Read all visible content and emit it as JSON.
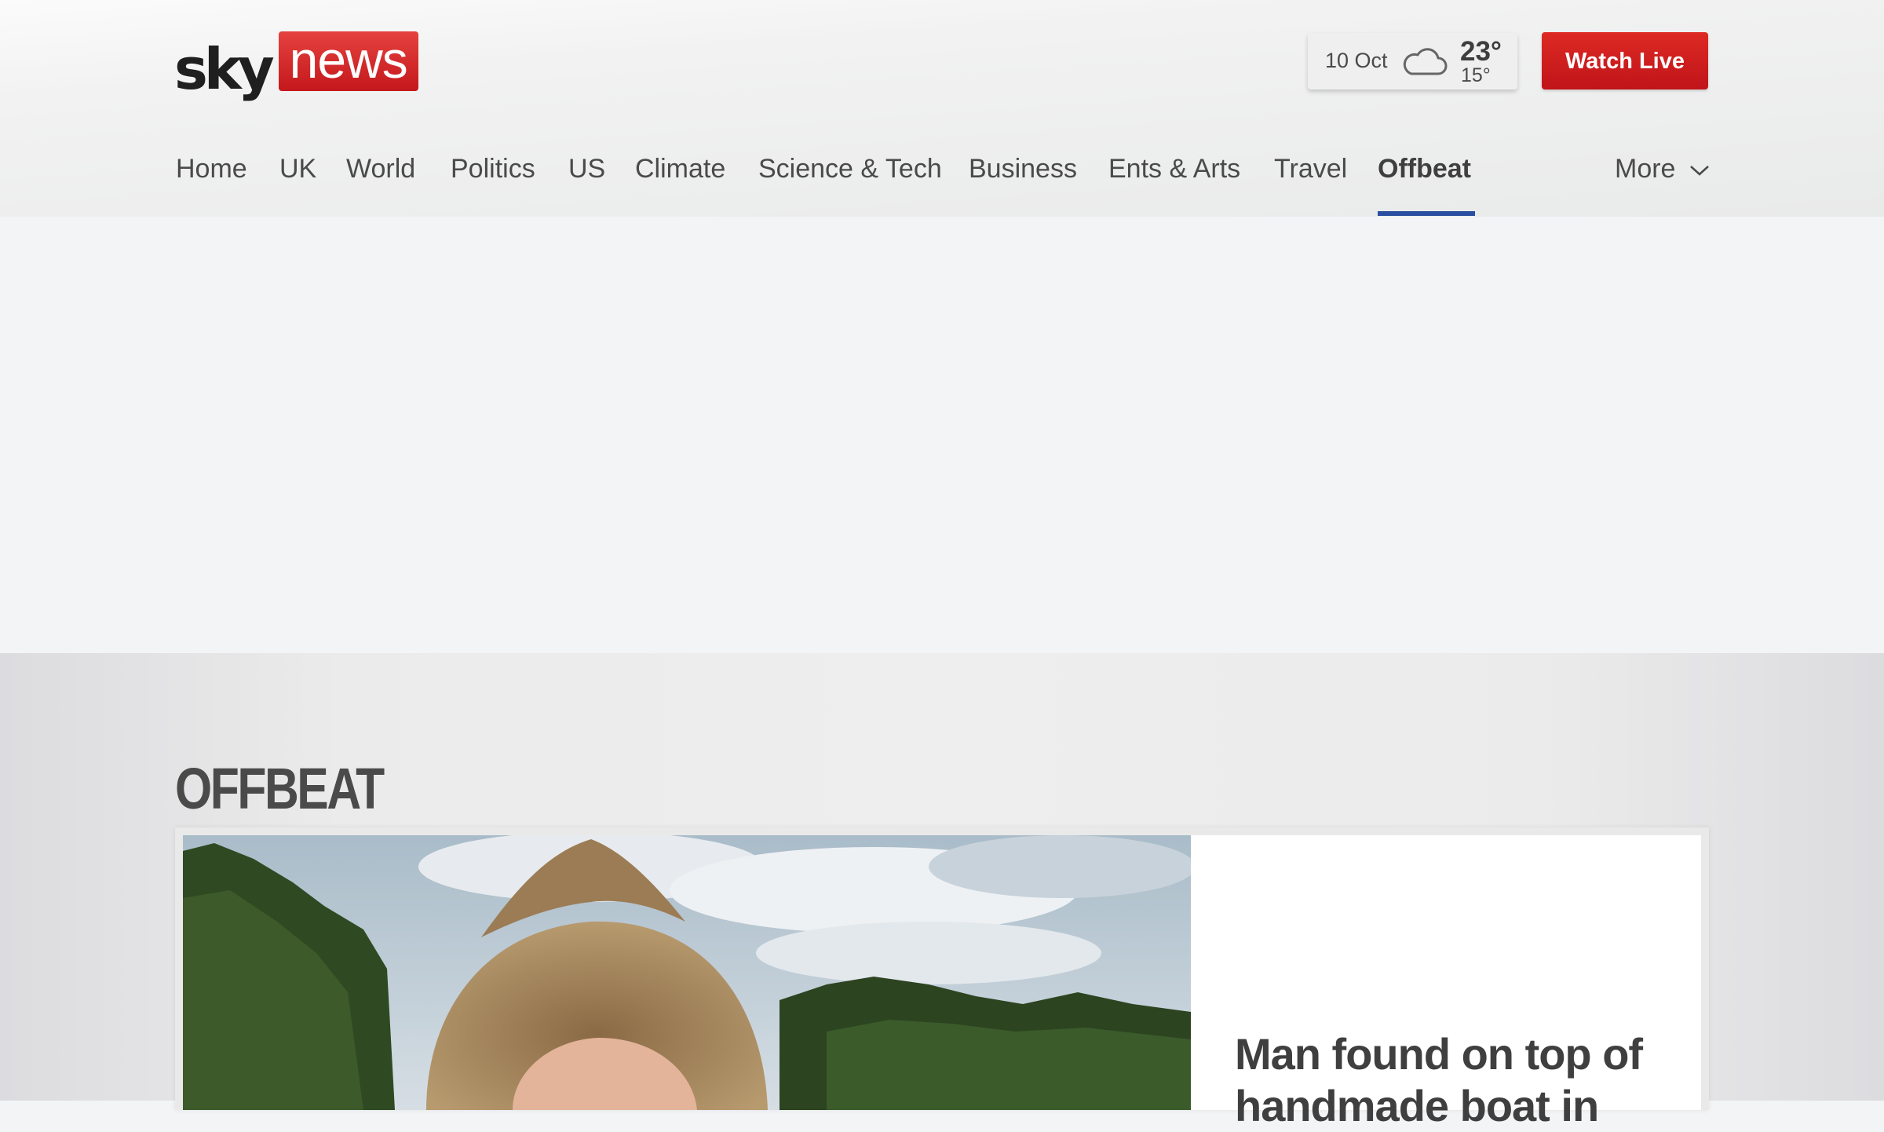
{
  "brand": {
    "sky": "sky",
    "news": "news"
  },
  "weather": {
    "date": "10 Oct",
    "icon": "cloud-icon",
    "high": "23°",
    "low": "15°"
  },
  "header": {
    "watch_live": "Watch Live"
  },
  "nav": {
    "items": [
      "Home",
      "UK",
      "World",
      "Politics",
      "US",
      "Climate",
      "Science & Tech",
      "Business",
      "Ents & Arts",
      "Travel",
      "Offbeat"
    ],
    "active": "Offbeat",
    "more": "More"
  },
  "section": {
    "title": "OFFBEAT"
  },
  "article": {
    "headline": "Man found on top of handmade boat in"
  },
  "colors": {
    "brand_red": "#c4181c",
    "accent_blue": "#2a4fa1",
    "text": "#4a4a4a"
  }
}
